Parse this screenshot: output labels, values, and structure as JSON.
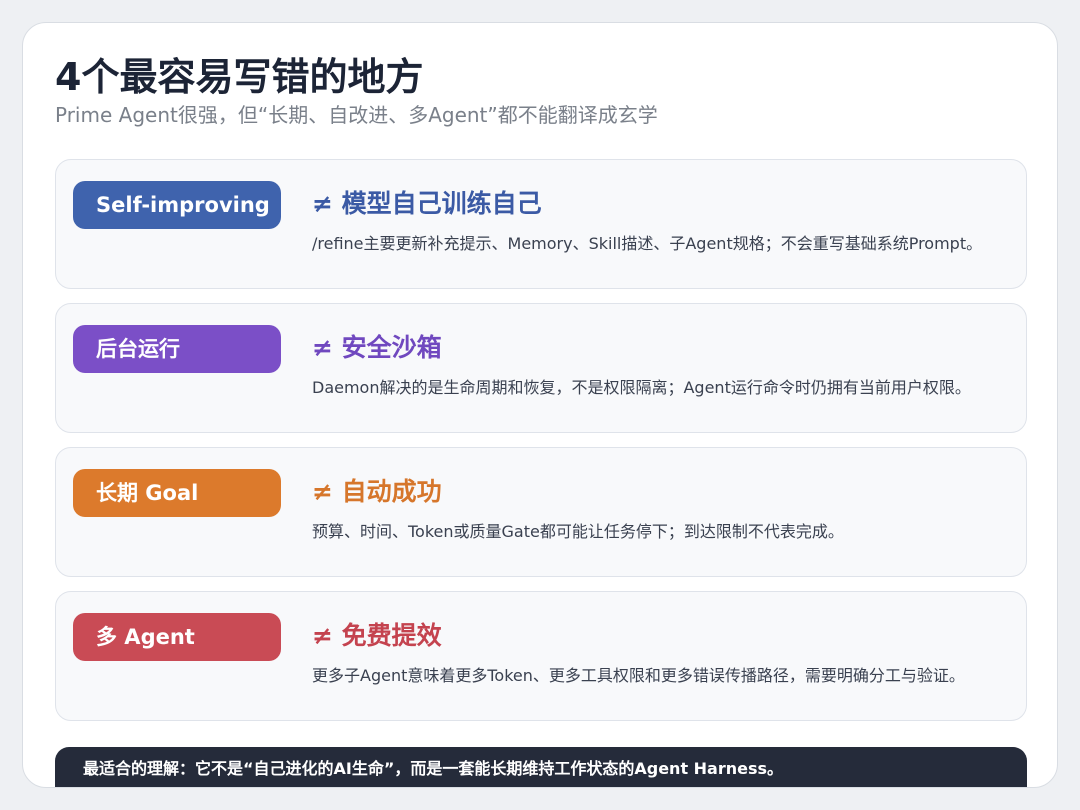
{
  "title": "4个最容易写错的地方",
  "subtitle": "Prime Agent很强，但“长期、自改进、多Agent”都不能翻译成玄学",
  "colors": {
    "blue": "#3f63ad",
    "purple": "#7b4fc7",
    "orange": "#dc7a2c",
    "red": "#c94b55",
    "footer_bg": "#252b3a"
  },
  "items": [
    {
      "tag": "Self-improving",
      "heading": "≠ 模型自己训练自己",
      "description": "/refine主要更新补充提示、Memory、Skill描述、子Agent规格；不会重写基础系统Prompt。",
      "color": "#3f63ad",
      "heading_color": "#3b5aa5"
    },
    {
      "tag": "后台运行",
      "heading": "≠ 安全沙箱",
      "description": "Daemon解决的是生命周期和恢复，不是权限隔离；Agent运行命令时仍拥有当前用户权限。",
      "color": "#7b4fc7",
      "heading_color": "#7048bf"
    },
    {
      "tag": "长期 Goal",
      "heading": "≠ 自动成功",
      "description": "预算、时间、Token或质量Gate都可能让任务停下；到达限制不代表完成。",
      "color": "#dc7a2c",
      "heading_color": "#d6762b"
    },
    {
      "tag": "多 Agent",
      "heading": "≠ 免费提效",
      "description": "更多子Agent意味着更多Token、更多工具权限和更多错误传播路径，需要明确分工与验证。",
      "color": "#c94b55",
      "heading_color": "#c4434f"
    }
  ],
  "footer": "最适合的理解：它不是“自己进化的AI生命”，而是一套能长期维持工作状态的Agent Harness。"
}
